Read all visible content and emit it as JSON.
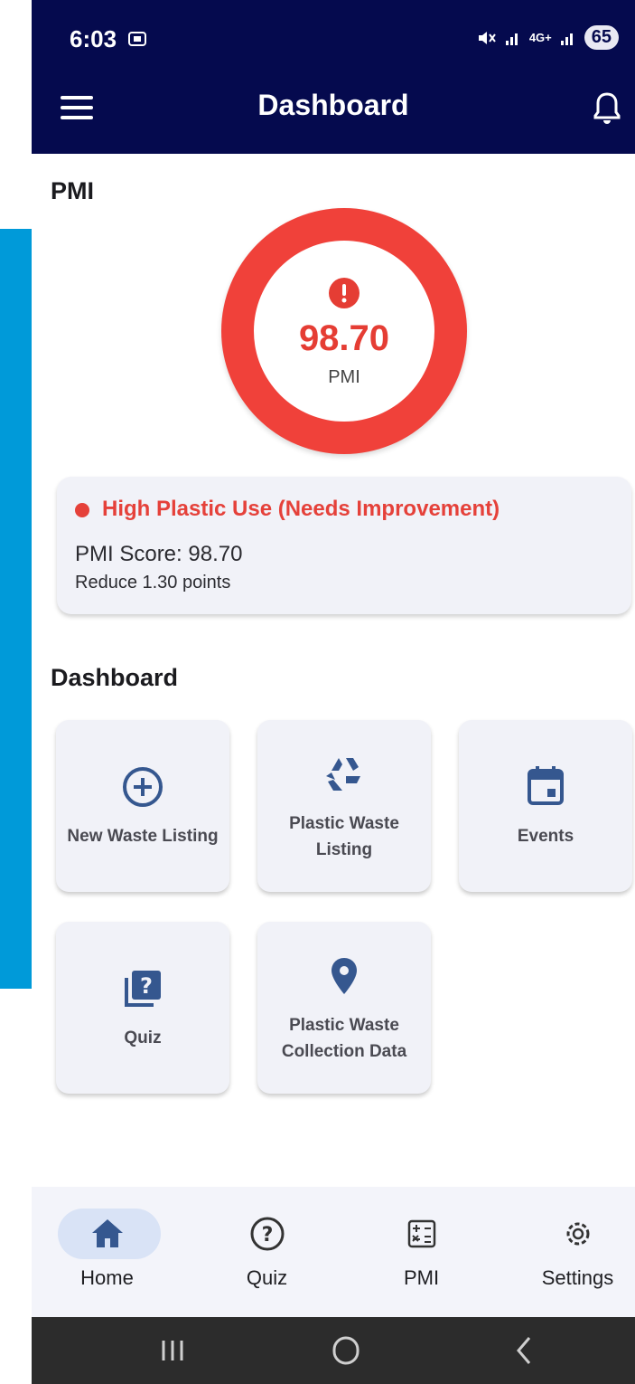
{
  "status_bar": {
    "time": "6:03",
    "network": "4G+",
    "battery": "65"
  },
  "header": {
    "title": "Dashboard",
    "menu_icon": "hamburger-menu-icon",
    "bell_icon": "bell-icon"
  },
  "pmi": {
    "section_title": "PMI",
    "value": "98.70",
    "label": "PMI",
    "ring_color": "#f0413a"
  },
  "status_card": {
    "status": "High Plastic Use (Needs Improvement)",
    "score": "PMI Score: 98.70",
    "reduce": "Reduce 1.30 points",
    "status_color": "#e5413a"
  },
  "dashboard": {
    "section_title": "Dashboard",
    "tiles": [
      {
        "label": "New Waste Listing",
        "icon": "add-circle-icon"
      },
      {
        "label": "Plastic Waste Listing",
        "icon": "recycle-icon"
      },
      {
        "label": "Events",
        "icon": "calendar-icon"
      },
      {
        "label": "Quiz",
        "icon": "quiz-icon"
      },
      {
        "label": "Plastic Waste Collection Data",
        "icon": "location-pin-icon"
      }
    ]
  },
  "bottom_nav": {
    "items": [
      {
        "label": "Home",
        "icon": "home-icon",
        "active": true
      },
      {
        "label": "Quiz",
        "icon": "help-circle-icon",
        "active": false
      },
      {
        "label": "PMI",
        "icon": "calculator-icon",
        "active": false
      },
      {
        "label": "Settings",
        "icon": "gear-icon",
        "active": false
      }
    ]
  },
  "colors": {
    "header_bg": "#050a4e",
    "accent_blue": "#35578f",
    "nav_active_pill": "#d9e3f6"
  }
}
